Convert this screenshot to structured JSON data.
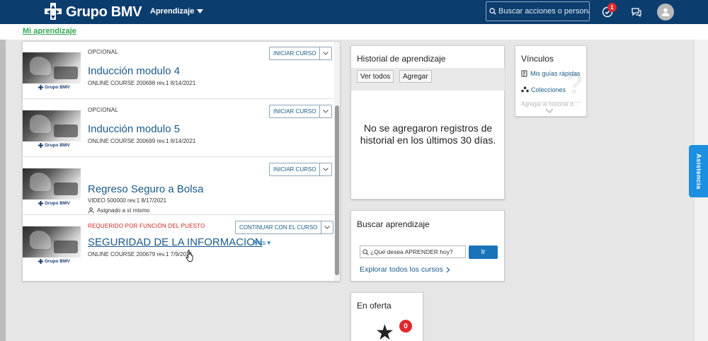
{
  "header": {
    "brand": "Grupo BMV",
    "nav_menu": "Aprendizaje",
    "search_placeholder": "Buscar acciones o personas",
    "notification_count": "1",
    "icons": [
      "checklist-icon",
      "feedback-icon",
      "user-avatar-icon"
    ],
    "accent_color": "#0b3d6e"
  },
  "breadcrumb": {
    "link": "Mi aprendizaje",
    "color": "#34a853"
  },
  "courses": [
    {
      "tag": "OPCIONAL",
      "title": "Inducción modulo 4",
      "meta": "ONLINE COURSE 200698 rev.1 8/14/2021",
      "action": "INICIAR CURSO",
      "thumb_brand": "Grupo BMV"
    },
    {
      "tag": "OPCIONAL",
      "title": "Inducción modulo 5",
      "meta": "ONLINE COURSE 200699 rev.1 8/14/2021",
      "action": "INICIAR CURSO",
      "thumb_brand": "Grupo BMV"
    },
    {
      "tag": "",
      "title": "Regreso Seguro a Bolsa",
      "meta": "VIDEO 500000 rev.1 8/17/2021",
      "assigned": "Asignado a sí mismo",
      "action": "INICIAR CURSO",
      "thumb_brand": "Grupo BMV"
    },
    {
      "tag": "REQUERIDO POR FUNCIÓN DEL PUESTO",
      "title": "SEGURIDAD DE LA INFORMACION",
      "more": "Más",
      "meta": "ONLINE COURSE 200679 rev.1 7/9/2021",
      "action": "CONTINUAR CON EL CURSO",
      "thumb_brand": "Grupo BMV",
      "tag_color": "#d0261d"
    }
  ],
  "history": {
    "title": "Historial de aprendizaje",
    "view_all": "Ver todos",
    "add": "Agregar",
    "empty_message": "No se agregaron registros de historial en los últimos 30 días."
  },
  "links": {
    "title": "Vínculos",
    "items": [
      {
        "label": "Mis guías rápidas",
        "icon": "quick-guide-icon"
      },
      {
        "label": "Colecciones",
        "icon": "collections-icon"
      },
      {
        "label": "Agregar al historial d...",
        "icon": ""
      }
    ]
  },
  "search_learning": {
    "title": "Buscar aprendizaje",
    "placeholder": "¿Qué desea APRENDER hoy?",
    "go_button": "Ir",
    "explore_link": "Explorar todos los cursos"
  },
  "offers": {
    "title": "En oferta",
    "count": "0"
  },
  "assist_tab": {
    "label": "Asistencia",
    "color": "#1c8fe0"
  }
}
